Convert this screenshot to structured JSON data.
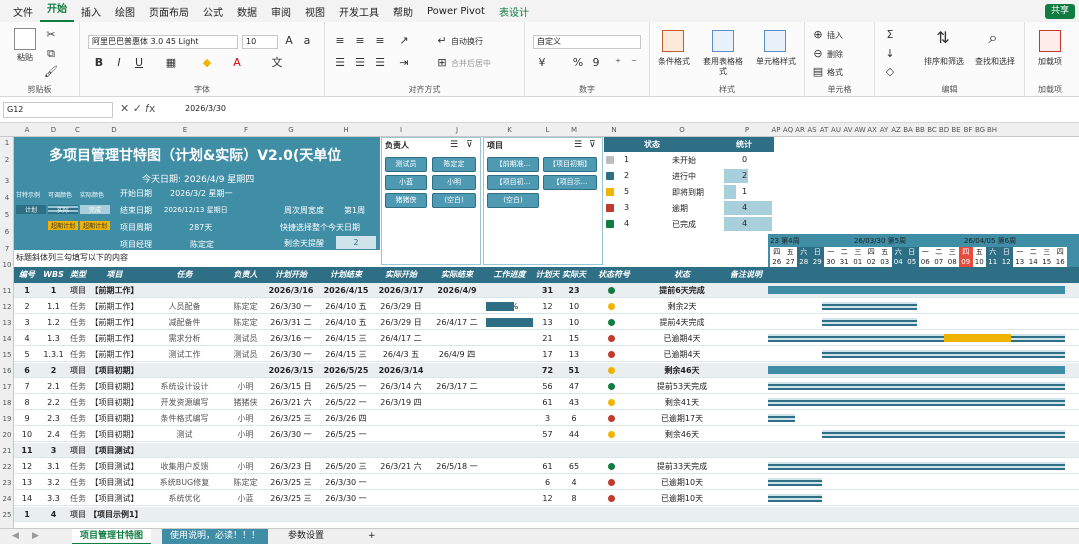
{
  "menu": {
    "items": [
      "文件",
      "开始",
      "插入",
      "绘图",
      "页面布局",
      "公式",
      "数据",
      "审阅",
      "视图",
      "开发工具",
      "帮助",
      "Power Pivot",
      "表设计"
    ],
    "share": "共享"
  },
  "ribbon": {
    "clipboard": {
      "paste": "粘贴",
      "label": "剪贴板"
    },
    "font": {
      "name": "阿里巴巴普惠体 3.0 45 Light",
      "size": "10",
      "label": "字体"
    },
    "align": {
      "wrap": "自动换行",
      "merge": "合并后居中",
      "label": "对齐方式"
    },
    "number": {
      "format": "自定义",
      "label": "数字"
    },
    "styles": {
      "cond": "条件格式",
      "table": "套用表格格式",
      "cell": "单元格样式",
      "label": "样式"
    },
    "cells": {
      "insert": "插入",
      "delete": "删除",
      "format": "格式",
      "label": "单元格"
    },
    "edit": {
      "sort": "排序和筛选",
      "find": "查找和选择",
      "label": "编辑"
    },
    "addin": {
      "btn": "加载项",
      "label": "加载项"
    }
  },
  "formula": {
    "name": "G12",
    "value": "2026/3/30"
  },
  "columns": [
    "A",
    "D",
    "C",
    "D",
    "E",
    "F",
    "G",
    "H",
    "I",
    "J",
    "K",
    "L",
    "M",
    "N",
    "O",
    "P",
    "AP",
    "AQ",
    "AR",
    "AS",
    "AT",
    "AU",
    "AV",
    "AW",
    "AX",
    "AY",
    "AZ",
    "BA",
    "BB",
    "BC",
    "BD",
    "BE",
    "BF",
    "BG",
    "BH"
  ],
  "rows": [
    "1",
    "2",
    "3",
    "4",
    "5",
    "6",
    "7",
    "10",
    "11",
    "12",
    "13",
    "14",
    "15",
    "16",
    "17",
    "18",
    "19",
    "20",
    "21",
    "22",
    "23",
    "24",
    "25"
  ],
  "sheet": {
    "title": "多项目管理甘特图（计划&实际）V2.0(天单位",
    "today_label": "今天日期:",
    "today_value": "2026/4/9 星期四",
    "legend": [
      "甘特示例",
      "可调颜色",
      "实际颜色"
    ],
    "legend2": [
      "计划",
      "实际",
      "完成",
      "超期计划",
      "超期计划"
    ],
    "start_label": "开始日期",
    "start_value": "2026/3/2 星期一",
    "end_label": "结束日期",
    "end_value": "2026/12/13 星期日",
    "dur_label": "项目周期",
    "dur_value": "287天",
    "mgr_label": "项目经理",
    "mgr_value": "陈定定",
    "week_label": "周次周宽度",
    "week_value": "第1周",
    "hint": "快捷选择整个今天日期",
    "remind_label": "剩余天提醒",
    "remind_value": "2",
    "note": "标题斜体列三勾填写以下的内容",
    "owner_slicer": {
      "title": "负责人",
      "items": [
        "测试员",
        "陈定定",
        "小蓝",
        "小明",
        "猪猪侠",
        "(空白)"
      ]
    },
    "proj_slicer": {
      "title": "项目",
      "items": [
        "【前期准...",
        "【项目初期】",
        "【项目初...",
        "【项目示...",
        "(空白)"
      ]
    },
    "status": {
      "h1": "状态",
      "h2": "统计",
      "rows": [
        [
          "1",
          "未开始",
          "0"
        ],
        [
          "2",
          "进行中",
          "2"
        ],
        [
          "5",
          "即将到期",
          "1"
        ],
        [
          "3",
          "逾期",
          "4"
        ],
        [
          "4",
          "已完成",
          "4"
        ]
      ]
    },
    "timeline": {
      "weeks": [
        "23 第4周",
        "26/03/30 第5周",
        "26/04/05 第6周"
      ],
      "dow": [
        "四",
        "五",
        "六",
        "日",
        "一",
        "二",
        "三",
        "四",
        "五",
        "六",
        "日",
        "一",
        "二",
        "三",
        "四",
        "五",
        "六",
        "日",
        "一",
        "二",
        "三",
        "四"
      ],
      "days": [
        "26",
        "27",
        "28",
        "29",
        "30",
        "31",
        "01",
        "02",
        "03",
        "04",
        "05",
        "06",
        "07",
        "08",
        "09",
        "10",
        "11",
        "12",
        "13",
        "14",
        "15",
        "16"
      ]
    },
    "headers": [
      "编号",
      "WBS",
      "类型",
      "项目",
      "任务",
      "负责人",
      "计划开始",
      "计划结束",
      "实际开始",
      "实际结束",
      "工作进度",
      "计划天数",
      "实际天数",
      "状态符号",
      "状态",
      "备注说明"
    ],
    "data": [
      [
        "1",
        "1",
        "项目",
        "【前期工作】",
        "",
        "",
        "2026/3/16",
        "2026/4/15",
        "2026/3/17",
        "2026/4/9",
        "",
        "31",
        "23",
        "",
        "提前6天完成",
        ""
      ],
      [
        "2",
        "1.1",
        "任务",
        "【前期工作】",
        "人员配备",
        "陈定定",
        "26/3/30 一",
        "26/4/10 五",
        "26/3/29 日",
        "",
        "60%",
        "12",
        "10",
        "",
        "剩余2天",
        ""
      ],
      [
        "3",
        "1.2",
        "任务",
        "【前期工作】",
        "减配备件",
        "陈定定",
        "26/3/31 二",
        "26/4/10 五",
        "26/3/29 日",
        "26/4/17 二",
        "100%",
        "13",
        "10",
        "",
        "提前4天完成",
        ""
      ],
      [
        "4",
        "1.3",
        "任务",
        "【前期工作】",
        "需求分析",
        "测试员",
        "26/3/16 一",
        "26/4/15 三",
        "26/4/17 二",
        "",
        "",
        "21",
        "15",
        "",
        "已逾期4天",
        ""
      ],
      [
        "5",
        "1.3.1",
        "任务",
        "【前期工作】",
        "测试工作",
        "测试员",
        "26/3/30 一",
        "26/4/15 三",
        "26/4/3 五",
        "26/4/9 四",
        "",
        "17",
        "13",
        "",
        "已逾期4天",
        ""
      ],
      [
        "6",
        "2",
        "项目",
        "【项目初期】",
        "",
        "",
        "2026/3/15",
        "2026/5/25",
        "2026/3/14",
        "",
        "",
        "72",
        "51",
        "",
        "剩余46天",
        ""
      ],
      [
        "7",
        "2.1",
        "任务",
        "【项目初期】",
        "系统设计设计",
        "小明",
        "26/3/15 日",
        "26/5/25 一",
        "26/3/14 六",
        "26/3/17 二",
        "",
        "56",
        "47",
        "",
        "提前53天完成",
        ""
      ],
      [
        "8",
        "2.2",
        "任务",
        "【项目初期】",
        "开发资源编写",
        "猪猪侠",
        "26/3/21 六",
        "26/5/22 一",
        "26/3/19 四",
        "",
        "",
        "61",
        "43",
        "",
        "剩余41天",
        ""
      ],
      [
        "9",
        "2.3",
        "任务",
        "【项目初期】",
        "条件格式编写",
        "小明",
        "26/3/25 三",
        "26/3/26 四",
        "",
        "",
        "",
        "3",
        "6",
        "",
        "已逾期17天",
        ""
      ],
      [
        "10",
        "2.4",
        "任务",
        "【项目初期】",
        "测试",
        "小明",
        "26/3/30 一",
        "26/5/25 一",
        "",
        "",
        "",
        "57",
        "44",
        "",
        "剩余46天",
        ""
      ],
      [
        "11",
        "3",
        "项目",
        "【项目测试】",
        "",
        "",
        "",
        "",
        "",
        "",
        "",
        "",
        "",
        "",
        "",
        ""
      ],
      [
        "12",
        "3.1",
        "任务",
        "【项目测试】",
        "收集用户反馈",
        "小明",
        "26/3/23 日",
        "26/5/20 三",
        "26/3/21 六",
        "26/5/18 一",
        "",
        "61",
        "65",
        "",
        "提前33天完成",
        ""
      ],
      [
        "13",
        "3.2",
        "任务",
        "【项目测试】",
        "系统BUG修复",
        "陈定定",
        "26/3/25 三",
        "26/3/30 一",
        "",
        "",
        "",
        "6",
        "4",
        "",
        "已逾期10天",
        ""
      ],
      [
        "14",
        "3.3",
        "任务",
        "【项目测试】",
        "系统优化",
        "小蓝",
        "26/3/25 三",
        "26/3/30 一",
        "",
        "",
        "",
        "12",
        "8",
        "",
        "已逾期10天",
        ""
      ],
      [
        "1",
        "4",
        "项目",
        "【项目示例1】",
        "",
        "",
        "",
        "",
        "",
        "",
        "",
        "",
        "",
        "",
        "",
        ""
      ]
    ]
  },
  "tabs": {
    "items": [
      "项目管理甘特图",
      "使用说明，必读！！！",
      "参数设置"
    ],
    "add": "+"
  },
  "colors": {
    "teal": "#3f8ea6",
    "tealdk": "#2e6f86",
    "green": "#107c41",
    "gold": "#f0b400",
    "today": "#e74c3c"
  }
}
